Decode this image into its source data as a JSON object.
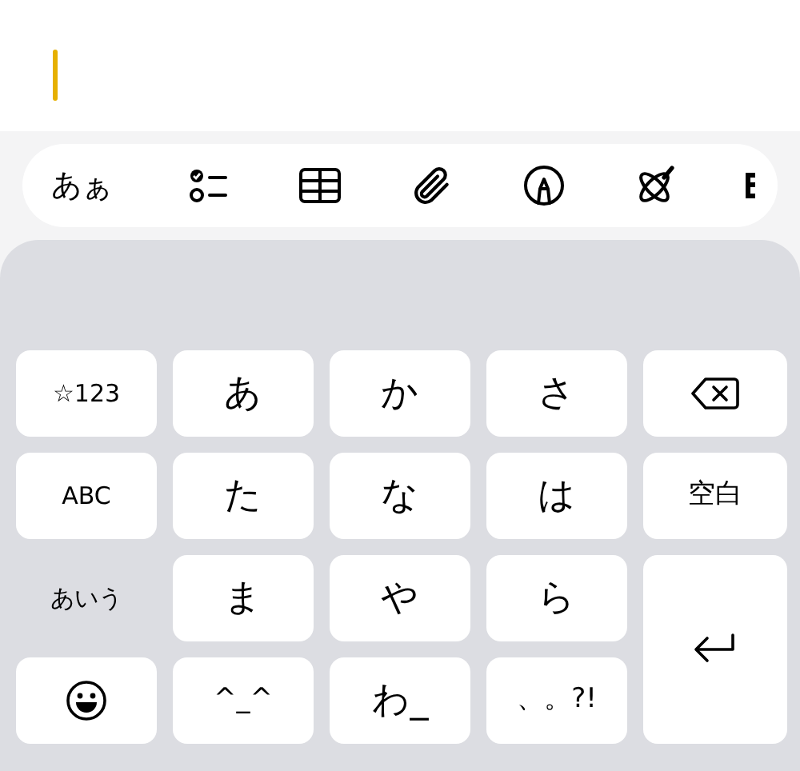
{
  "toolbar": {
    "items": [
      {
        "kind": "text",
        "label": "あぁ"
      },
      {
        "kind": "checklist"
      },
      {
        "kind": "table"
      },
      {
        "kind": "attachment"
      },
      {
        "kind": "markup"
      },
      {
        "kind": "ai"
      },
      {
        "kind": "partial"
      }
    ]
  },
  "keyboard": {
    "keys": [
      {
        "kind": "mode",
        "label": "☆123",
        "selected": false
      },
      {
        "kind": "char",
        "label": "あ"
      },
      {
        "kind": "char",
        "label": "か"
      },
      {
        "kind": "char",
        "label": "さ"
      },
      {
        "kind": "backspace"
      },
      {
        "kind": "mode",
        "label": "ABC",
        "selected": false
      },
      {
        "kind": "char",
        "label": "た"
      },
      {
        "kind": "char",
        "label": "な"
      },
      {
        "kind": "char",
        "label": "は"
      },
      {
        "kind": "small",
        "label": "空白"
      },
      {
        "kind": "mode",
        "label": "あいう",
        "selected": true
      },
      {
        "kind": "char",
        "label": "ま"
      },
      {
        "kind": "char",
        "label": "や"
      },
      {
        "kind": "char",
        "label": "ら"
      },
      {
        "kind": "return"
      },
      {
        "kind": "emoji"
      },
      {
        "kind": "small",
        "label": "^_^"
      },
      {
        "kind": "char",
        "label": "わ_"
      },
      {
        "kind": "small",
        "label": "、。?!"
      }
    ]
  }
}
